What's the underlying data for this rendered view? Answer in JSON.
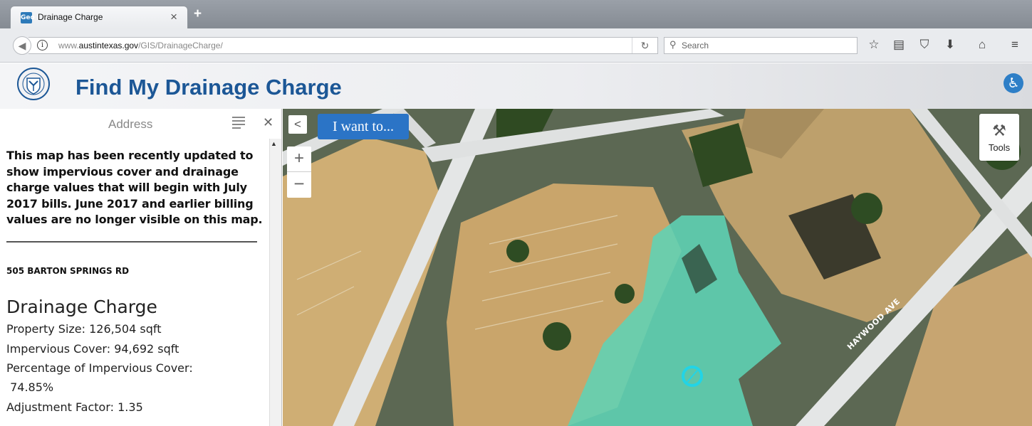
{
  "browser": {
    "tab_title": "Drainage Charge",
    "tab_close": "×",
    "new_tab": "+",
    "favicon_text": "Geo",
    "url_prefix": "www.",
    "url_domain": "austintexas.gov",
    "url_path": "/GIS/DrainageCharge/",
    "search_placeholder": "Search",
    "toolbar_icons": [
      "bookmark-star-icon",
      "reading-list-icon",
      "pocket-icon",
      "download-icon",
      "home-icon",
      "menu-icon"
    ]
  },
  "app": {
    "title": "Find My Drainage Charge",
    "accessibility_icon": "wheelchair-icon"
  },
  "panel": {
    "title": "Address",
    "notice": "This map has been recently updated to show impervious cover and drainage charge values that will begin with July 2017 bills.  June 2017 and earlier billing values are no longer visible on this map.",
    "address": "505 BARTON SPRINGS RD",
    "section_title": "Drainage Charge",
    "property_size": "Property Size:  126,504 sqft",
    "impervious_cover": "Impervious Cover:  94,692 sqft",
    "pct_label": "Percentage of Impervious Cover:",
    "pct_value": " 74.85%",
    "adjustment": "Adjustment Factor:  1.35"
  },
  "map": {
    "collapse_label": "<",
    "iwant_label": "I want to...",
    "zoom_in": "+",
    "zoom_out": "−",
    "tools_label": "Tools",
    "street_label": "HAYWOOD AVE",
    "colors": {
      "impervious": "#cfae74",
      "parcel_highlight": "#5fd3b5",
      "road": "#e4e6e6",
      "vegetation": "#2f4a22",
      "marker": "#22d4e6"
    }
  }
}
